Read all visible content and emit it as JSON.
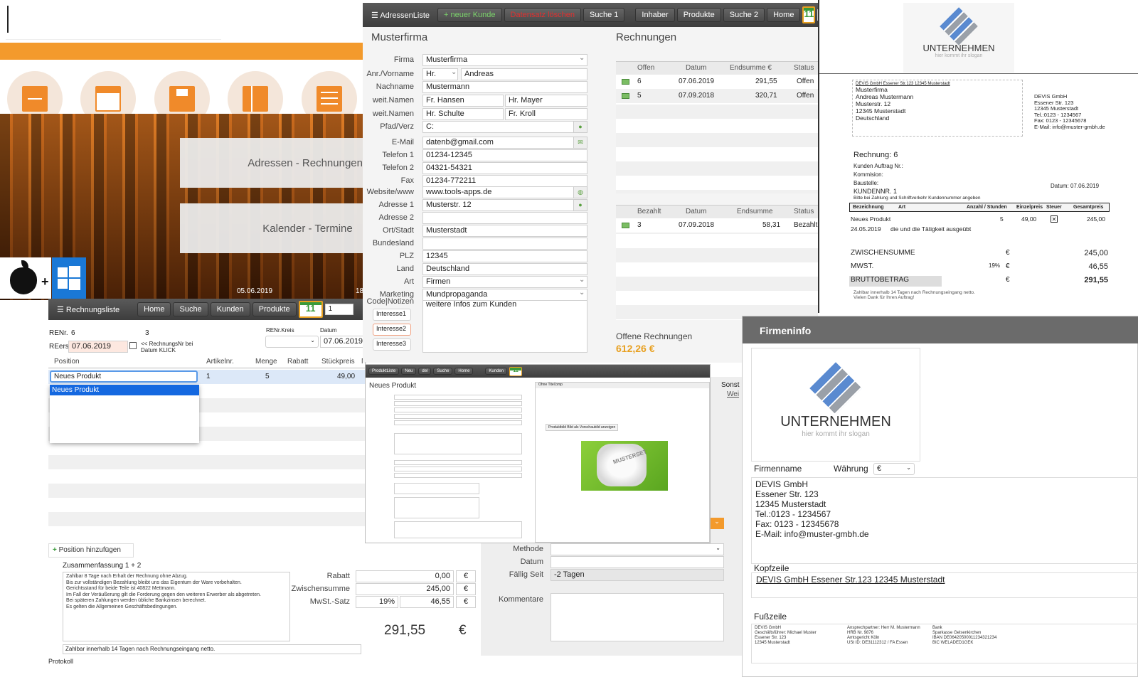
{
  "home": {
    "date": "05.06.2019",
    "date2": "18",
    "btn_adressen": "Adressen - Rechnungen",
    "btn_kalender": "Kalender - Termine"
  },
  "icons": {
    "apple": "apple-icon",
    "windows": "windows-icon",
    "plus": "plus-icon",
    "calendar": "calendar-icon",
    "envelope": "envelope-icon",
    "floppy": "floppy-icon",
    "book": "book-icon",
    "list": "list-icon"
  },
  "colors": {
    "accent": "#f39a2c",
    "toolbar": "#4a4a4a",
    "link_orange": "#e8a020",
    "selection": "#1468e0"
  },
  "address": {
    "toolbar": {
      "list": "AdressenListe",
      "new": "+ neuer Kunde",
      "delete": "Datensatz löschen",
      "search1": "Suche 1",
      "owner": "Inhaber",
      "products": "Produkte",
      "search2": "Suche 2",
      "home": "Home",
      "cal": "11",
      "page": "1"
    },
    "title": "Musterfirma",
    "fields": [
      {
        "label": "Firma",
        "value": "Musterfirma"
      },
      {
        "label": "Anr./Vorname",
        "value": "Hr.",
        "value2": "Andreas"
      },
      {
        "label": "Nachname",
        "value": "Mustermann"
      },
      {
        "label": "weit.Namen",
        "value": "Fr. Hansen",
        "value2": "Hr. Mayer"
      },
      {
        "label": "weit.Namen",
        "value": "Hr. Schulte",
        "value2": "Fr. Kroll"
      },
      {
        "label": "Pfad/Verz",
        "value": "C:"
      },
      {
        "label": "E-Mail",
        "value": "datenb@gmail.com"
      },
      {
        "label": "Telefon 1",
        "value": "01234-12345"
      },
      {
        "label": "Telefon 2",
        "value": "04321-54321"
      },
      {
        "label": "Fax",
        "value": "01234-772211"
      },
      {
        "label": "Website/www",
        "value": "www.tools-apps.de"
      },
      {
        "label": "Adresse 1",
        "value": "Musterstr. 12"
      },
      {
        "label": "Adresse 2",
        "value": ""
      },
      {
        "label": "Ort/Stadt",
        "value": "Musterstadt"
      },
      {
        "label": "Bundesland",
        "value": ""
      },
      {
        "label": "PLZ",
        "value": "12345"
      },
      {
        "label": "Land",
        "value": "Deutschland"
      },
      {
        "label": "Art",
        "value": "Firmen"
      },
      {
        "label": "Marketing",
        "value": "Mundpropaganda"
      }
    ],
    "code_label": "Code|Notizen",
    "interessen": [
      "Interesse1",
      "Interesse2",
      "Interesse3"
    ],
    "notes": "weitere Infos zum Kunden"
  },
  "rechnungen": {
    "title": "Rechnungen",
    "open_headers": [
      "Offen",
      "Datum",
      "Endsumme €",
      "Status"
    ],
    "open_rows": [
      {
        "nr": "6",
        "datum": "07.06.2019",
        "summe": "291,55",
        "status": "Offen"
      },
      {
        "nr": "5",
        "datum": "07.09.2018",
        "summe": "320,71",
        "status": "Offen"
      }
    ],
    "paid_headers": [
      "Bezahlt",
      "Datum",
      "Endsumme",
      "Status"
    ],
    "paid_rows": [
      {
        "nr": "3",
        "datum": "07.09.2018",
        "summe": "58,31",
        "status": "Bezahlt"
      }
    ],
    "open_label": "Offene Rechnungen",
    "open_total": "612,26 €"
  },
  "invoice_doc": {
    "logo": "UNTERNEHMEN",
    "slogan": "hier kommt ihr slogan",
    "sender_line": "DEVIS GmbH Essener Str.123 12345 Musterstadt",
    "recipient": [
      "Musterfirma",
      "Andreas Mustermann",
      "Musterstr. 12",
      "12345 Musterstadt",
      "Deutschland"
    ],
    "company": [
      "DEVIS GmbH",
      "Essener Str. 123",
      "12345 Musterstadt",
      "Tel.:0123 - 1234567",
      "Fax: 0123 - 12345678",
      "E-Mail: info@muster-gmbh.de"
    ],
    "rechnung": "Rechnung: 6",
    "meta": [
      "Kunden Auftrag Nr.:",
      "Kommision:",
      "Baustelle:"
    ],
    "datum": "Datum: 07.06.2019",
    "kundennr": "KUNDENNR.  1",
    "kundennr_note": "Bitte bei Zahlung und Schriftverkehr Kundennummer angeben",
    "headers": [
      "Bezeichnung",
      "Art",
      "Anzahl / Stunden",
      "Einzelpreis",
      "Steuer",
      "Gesamtpreis"
    ],
    "item": {
      "name": "Neues Produkt",
      "anzahl": "5",
      "preis": "49,00",
      "gesamt": "245,00",
      "date": "24.05.2019",
      "desc": "die und die Tätigkeit ausgeübt"
    },
    "zwischensumme_label": "ZWISCHENSUMME",
    "zwischensumme": "245,00",
    "mwst_label": "MWST.",
    "mwst_rate": "19%",
    "mwst": "46,55",
    "brutto_label": "BRUTTOBETRAG",
    "brutto": "291,55",
    "currency": "€",
    "footer": [
      "Zahlbar innerhalb 14 Tagen nach Rechnungseingang netto.",
      "Vielen Dank für Ihren Auftrag!"
    ]
  },
  "rechnungsliste": {
    "toolbar": {
      "list": "Rechnungsliste",
      "home": "Home",
      "search": "Suche",
      "customers": "Kunden",
      "products": "Produkte",
      "cal": "11",
      "page": "1"
    },
    "renr_label": "RENr.",
    "renr": "6",
    "renr2": "3",
    "rekreis_label": "RENr.Kreis",
    "datum_label": "Datum",
    "reers_label": "REers",
    "reers": "07.06.2019",
    "hint": "<< RechnungsNr bei Datum KLICK",
    "datum": "07.06.2019",
    "headers": [
      "Position",
      "Artikelnr.",
      "Menge",
      "Rabatt",
      "Stückpreis",
      "N"
    ],
    "row": {
      "position": "Neues Produkt",
      "artikel": "1",
      "menge": "5",
      "preis": "49,00"
    },
    "dropdown_item": "Neues Produkt",
    "add_position": "Position hinzufügen",
    "summary_label": "Zusammenfassung 1 + 2",
    "terms": [
      "Zahlbar 8 Tage nach Erhalt der Rechnung ohne Abzug.",
      "Bis zur vollständigen Bezahlung bleibt uns das Eigentum der Ware vorbehalten.",
      "Gerichtsstand für beide Teile ist 40822 Mettmann.",
      "Im Fall der Veräußerung gilt die Forderung gegen den weiteren Erwerber als abgetreten.",
      "Bei späteren Zahlungen werden übliche Bankzinsen berechnet.",
      "Es gelten die Allgemeinen Geschäftsbedingungen."
    ],
    "rabatt_label": "Rabatt",
    "rabatt": "0,00",
    "zwischensumme_label": "Zwischensumme",
    "zwischensumme": "245,00",
    "mwst_label": "MwSt.-Satz",
    "mwst_rate": "19%",
    "mwst": "46,55",
    "currency": "€",
    "total": "291,55",
    "note": "Zahlbar innerhalb 14 Tagen nach Rechnungseingang netto.",
    "protokoll": "Protokoll"
  },
  "produkt": {
    "toolbar": {
      "list": "ProduktListe",
      "new": "Neu",
      "delete": "del",
      "search": "Suche",
      "home": "Home",
      "customers": "Kunden",
      "cal": "11"
    },
    "title": "Neues Produkt",
    "image_button": "Produktbild Bild als Vorschaubild anzeigen",
    "image_label": "MUSTERSET",
    "preview_title": "Ohne Titel.bmp"
  },
  "payment": {
    "sonst": "Sonst",
    "wei": "Wei",
    "methode": "Methode",
    "datum": "Datum",
    "faellig": "Fällig Seit",
    "faellig_value": "-2 Tagen",
    "kommentare": "Kommentare"
  },
  "firmeninfo": {
    "title": "Firmeninfo",
    "logo": "UNTERNEHMEN",
    "slogan": "hier kommt ihr slogan",
    "firmenname_label": "Firmenname",
    "waehrung_label": "Währung",
    "waehrung": "€",
    "address": [
      "DEVIS GmbH",
      "Essener Str. 123",
      "12345 Musterstadt",
      "Tel.:0123 - 1234567",
      "Fax: 0123 - 12345678",
      "E-Mail: info@muster-gmbh.de"
    ],
    "kopfzeile_label": "Kopfzeile",
    "kopfzeile": "DEVIS GmbH Essener Str.123 12345 Musterstadt",
    "fusszeile_label": "Fußzeile",
    "fuss_col1": [
      "DEVIS GmbH",
      "Geschäftsführer: Michael Muster",
      "Essener Str. 123",
      "12345 Musterstadt"
    ],
    "fuss_col2": [
      "Ansprechpartner: Herr M. Mustermann",
      "HRB Nr. 9876",
      "Amtsgericht Köln",
      "USt ID: DE31112312 / FA Essen"
    ],
    "fuss_col3": [
      "Bank",
      "Sparkasse Gelsenkirchen",
      "IBAN DE06420500011234321234",
      "BIC   WELADED1GEK"
    ]
  }
}
